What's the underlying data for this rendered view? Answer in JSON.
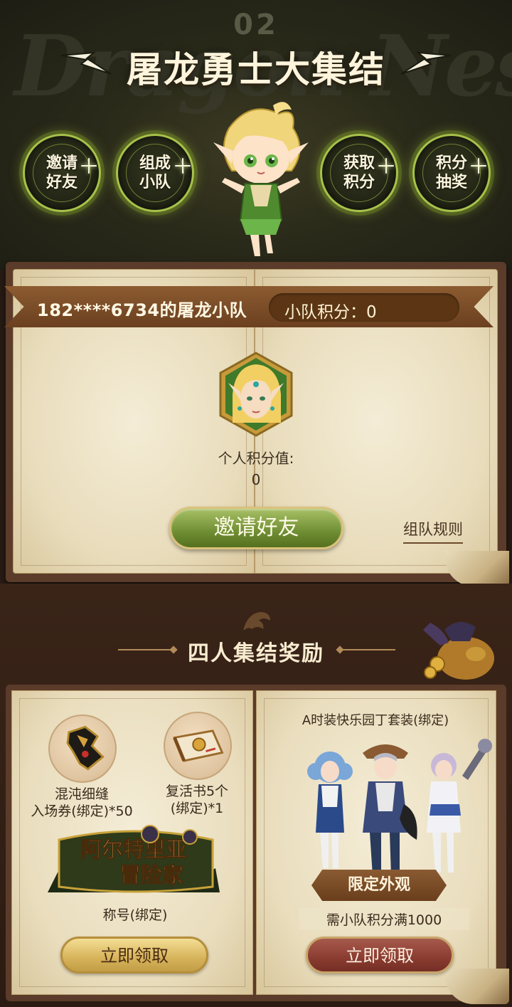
{
  "hero": {
    "watermark": "Dragon Nest",
    "number": "02",
    "title": "屠龙勇士大集结",
    "steps": [
      {
        "line1": "邀请",
        "line2": "好友"
      },
      {
        "line1": "组成",
        "line2": "小队"
      },
      {
        "line1": "获取",
        "line2": "积分"
      },
      {
        "line1": "积分",
        "line2": "抽奖"
      }
    ]
  },
  "team": {
    "name": "182****6734的屠龙小队",
    "score_text": "小队积分：0",
    "personal_label": "个人积分值:",
    "personal_value": "0",
    "invite_button": "邀请好友",
    "rules_link": "组队规则"
  },
  "rewards": {
    "section_title": "四人集结奖励",
    "left_items": [
      {
        "line1": "混沌细缝",
        "line2": "入场券(绑定)*50"
      },
      {
        "line1": "复活书5个",
        "line2": "(绑定)*1"
      }
    ],
    "badge_text_1": "阿尔特里亚",
    "badge_text_2": "冒险家",
    "badge_caption": "称号(绑定)",
    "claim_left": "立即领取",
    "outfit_title": "A时装快乐园丁套装(绑定)",
    "limited_tag": "限定外观",
    "requirement": "需小队积分满1000",
    "claim_right": "立即领取"
  },
  "colors": {
    "accent_green": "#a8c24a",
    "button_green": "#6f8e33",
    "ribbon_brown": "#7b4a24",
    "claim_red": "#8a3c30",
    "claim_gold": "#d6b35a"
  }
}
